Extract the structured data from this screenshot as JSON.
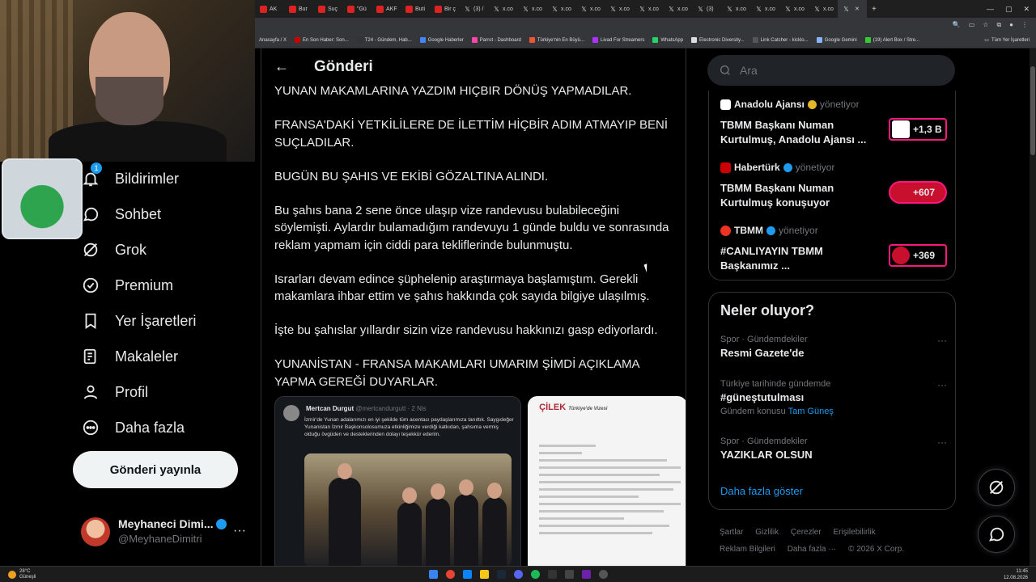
{
  "browser": {
    "tabs": [
      {
        "label": "AK"
      },
      {
        "label": "Bur"
      },
      {
        "label": "Suç"
      },
      {
        "label": "\"Gü"
      },
      {
        "label": "AKF"
      },
      {
        "label": "Buti"
      },
      {
        "label": "Bir ç"
      },
      {
        "label": "(3) /"
      },
      {
        "label": "x.co"
      },
      {
        "label": "x.co"
      },
      {
        "label": "x.co"
      },
      {
        "label": "x.co"
      },
      {
        "label": "x.co"
      },
      {
        "label": "x.co"
      },
      {
        "label": "x.co"
      },
      {
        "label": "(3)"
      },
      {
        "label": "x.co"
      },
      {
        "label": "x.co"
      },
      {
        "label": "x.co"
      },
      {
        "label": "x.co"
      },
      {
        "label": "x.co"
      },
      {
        "label": ""
      }
    ],
    "bookmarks": [
      "Anasayfa / X",
      "En Son Haber: Son...",
      "T24 - Gündem, Hab...",
      "Google Haberler",
      "Parrot - Dashboard",
      "Türkiye'nin En Büyü...",
      "Livad For Streamers",
      "WhatsApp",
      "Electronic Diversity...",
      "Link Catcher - kicklo...",
      "Google Gemini",
      "(19) Alert Box / Stre..."
    ],
    "bookmarks_right": "Tüm Yer İşaretleri"
  },
  "nav": {
    "items": [
      {
        "label": "Bildirimler",
        "badge": "1"
      },
      {
        "label": "Sohbet"
      },
      {
        "label": "Grok"
      },
      {
        "label": "Premium"
      },
      {
        "label": "Yer İşaretleri"
      },
      {
        "label": "Makaleler"
      },
      {
        "label": "Profil"
      },
      {
        "label": "Daha fazla"
      }
    ],
    "post_button": "Gönderi yayınla",
    "profile": {
      "name": "Meyhaneci Dimi...",
      "handle": "@MeyhaneDimitri"
    }
  },
  "main": {
    "title": "Gönderi",
    "paragraphs": [
      "YUNAN MAKAMLARINA YAZDIM HIÇBIR DÖNÜŞ YAPMADILAR.",
      "FRANSA'DAKİ YETKİLİLERE DE İLETTİM HİÇBİR ADIM ATMAYIP BENİ SUÇLADILAR.",
      "BUGÜN BU ŞAHIS VE EKİBİ GÖZALTINA ALINDI.",
      "Bu şahıs bana 2 sene önce ulaşıp vize randevusu bulabileceğini söylemişti. Aylardır bulamadığım randevuyu 1 günde buldu ve sonrasında reklam yapmam için ciddi para tekliflerinde bulunmuştu.",
      "Israrları devam edince şüphelenip araştırmaya başlamıştım. Gerekli makamlara ihbar ettim ve şahıs hakkında çok sayıda bilgiye ulaşılmış.",
      "İşte bu şahıslar yıllardır sizin vize randevusu hakkınızı gasp ediyorlardı.",
      "YUNANİSTAN - FRANSA MAKAMLARI UMARIM ŞİMDİ AÇIKLAMA YAPMA GEREĞİ DUYARLAR."
    ],
    "media": {
      "quote_name": "Mertcan Durgut",
      "quote_handle": "@mertcandurgutt · 2 Nis",
      "quote_text": "İzmir'de Yunan adalarımızı en iyi şekilde tüm acentacı paydaşlarımıza tanıttık. Saygıdeğer Yunanistan İzmir Başkonsolosumuza etkinliğimize verdiği katkıdan, şahsıma vermiş olduğu övgüden ve desteklerinden dolayı teşekkür ederim.",
      "doc_logo": "ÇİLEK",
      "doc_logo_sub": "Türkiye'de Vizesi"
    }
  },
  "right": {
    "search_placeholder": "Ara",
    "news": [
      {
        "source": "Anadolu Ajansı",
        "managed": "yönetiyor",
        "title": "TBMM Başkanı Numan Kurtulmuş, Anadolu Ajansı ...",
        "count": "+1,3 B"
      },
      {
        "source": "Habertürk",
        "managed": "yönetiyor",
        "title": "TBMM Başkanı Numan Kurtulmuş konuşuyor",
        "count": "+607"
      },
      {
        "source": "TBMM",
        "managed": "yönetiyor",
        "title": "#CANLIYAYIN TBMM Başkanımız ...",
        "count": "+369"
      }
    ],
    "trends_title": "Neler oluyor?",
    "trends": [
      {
        "category": "Spor · Gündemdekiler",
        "title": "Resmi Gazete'de",
        "sub": "",
        "sub_link": ""
      },
      {
        "category": "Türkiye tarihinde gündemde",
        "title": "#güneştutulması",
        "sub": "Gündem konusu",
        "sub_link": "Tam Güneş"
      },
      {
        "category": "Spor · Gündemdekiler",
        "title": "YAZIKLAR OLSUN",
        "sub": "",
        "sub_link": ""
      }
    ],
    "show_more": "Daha fazla göster",
    "footer": [
      "Şartlar",
      "Gizlilik",
      "Çerezler",
      "Erişilebilirlik",
      "Reklam Bilgileri",
      "Daha fazla ···",
      "© 2026 X Corp."
    ]
  },
  "taskbar": {
    "temp": "28°C",
    "weather": "Güneşli",
    "time": "11:45",
    "date": "12.08.2026"
  }
}
